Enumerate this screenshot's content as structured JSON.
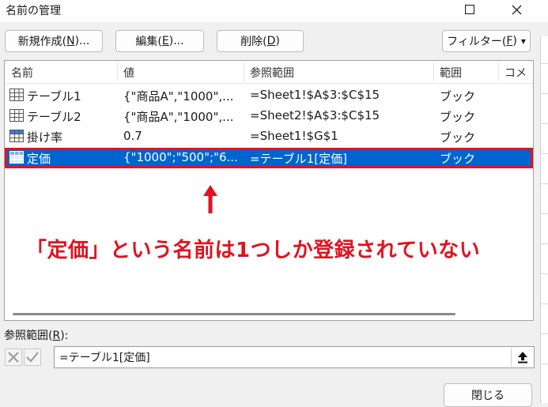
{
  "window": {
    "title": "名前の管理"
  },
  "toolbar": {
    "new_prefix": "新規作成(",
    "new_key": "N",
    "new_suffix": ")...",
    "edit_prefix": "編集(",
    "edit_key": "E",
    "edit_suffix": ")...",
    "delete_prefix": "削除(",
    "delete_key": "D",
    "delete_suffix": ")",
    "filter_prefix": "フィルター(",
    "filter_key": "F",
    "filter_suffix": ")",
    "filter_arrow": "▾"
  },
  "columns": [
    "名前",
    "値",
    "参照範囲",
    "範囲",
    "コメ"
  ],
  "rows": [
    {
      "icon": "table-icon",
      "name": "テーブル1",
      "value": "{\"商品A\",\"1000\",...",
      "ref": "=Sheet1!$A$3:$C$15",
      "scope": "ブック",
      "selected": false
    },
    {
      "icon": "table-icon",
      "name": "テーブル2",
      "value": "{\"商品A\",\"1000\",...",
      "ref": "=Sheet2!$A$3:$C$15",
      "scope": "ブック",
      "selected": false
    },
    {
      "icon": "named-range-icon",
      "name": "掛け率",
      "value": "0.7",
      "ref": "=Sheet1!$G$1",
      "scope": "ブック",
      "selected": false
    },
    {
      "icon": "named-range-icon",
      "name": "定価",
      "value": "{\"1000\";\"500\";\"6...",
      "ref": "=テーブル1[定価]",
      "scope": "ブック",
      "selected": true
    }
  ],
  "annotation": {
    "text": "「定価」という名前は1つしか登録されていない",
    "color": "#e2121f"
  },
  "ref_bar": {
    "label_prefix": "参照範囲(",
    "label_key": "R",
    "label_suffix": "):",
    "value": "=テーブル1[定価]"
  },
  "footer": {
    "close_label": "閉じる"
  },
  "colors": {
    "selection": "#0064d1",
    "highlight_border": "#e2121f"
  }
}
